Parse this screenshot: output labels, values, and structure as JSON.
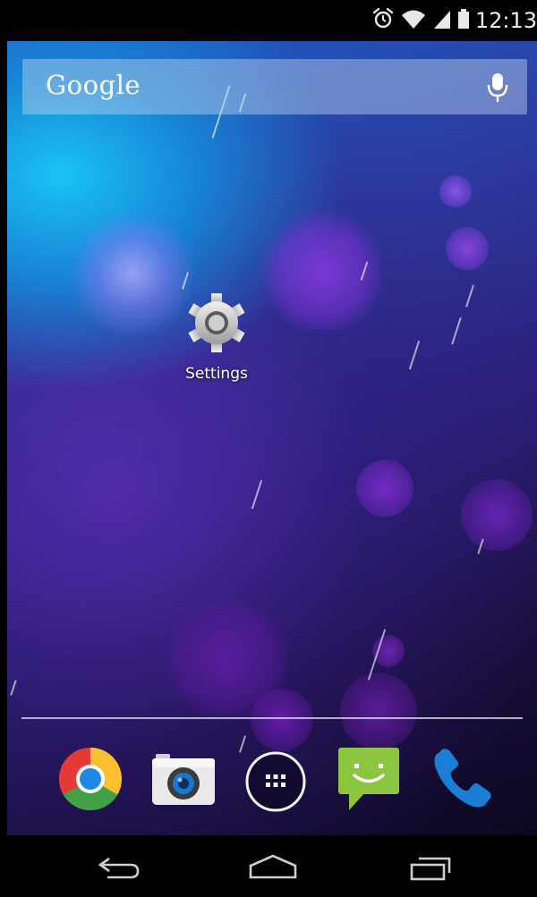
{
  "status_bar": {
    "time": "12:13",
    "icons": [
      "alarm-icon",
      "wifi-icon",
      "cell-signal-icon",
      "battery-icon"
    ]
  },
  "search_bar": {
    "brand": "Google",
    "icon": "microphone-icon"
  },
  "home_icons": [
    {
      "label": "Settings",
      "icon": "settings-gear-icon"
    }
  ],
  "dock": [
    {
      "name": "chrome",
      "icon": "chrome-icon"
    },
    {
      "name": "camera",
      "icon": "camera-icon"
    },
    {
      "name": "app-drawer",
      "icon": "all-apps-icon"
    },
    {
      "name": "messaging",
      "icon": "messaging-icon"
    },
    {
      "name": "phone",
      "icon": "phone-icon"
    }
  ],
  "nav_bar": {
    "buttons": [
      "back-icon",
      "home-icon",
      "recents-icon"
    ]
  },
  "colors": {
    "wallpaper_top": "#19c3f6",
    "wallpaper_bottom": "#0b0720",
    "orb_purple": "#7b33c8",
    "messaging_green": "#8cc63f",
    "phone_blue": "#1a7fd4"
  }
}
